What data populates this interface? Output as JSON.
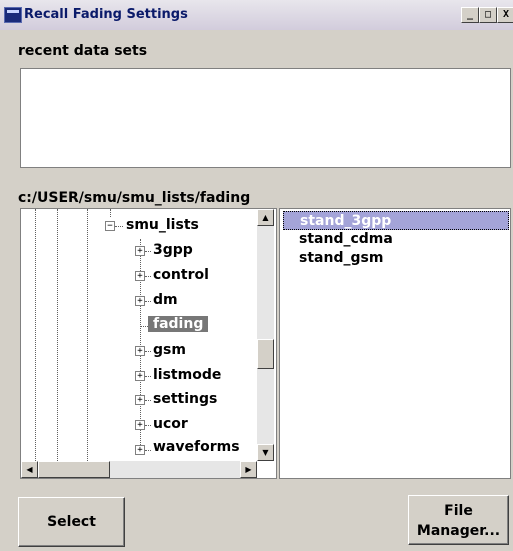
{
  "window": {
    "title": "Recall Fading Settings",
    "minimize": "_",
    "maximize": "□",
    "close": "X"
  },
  "recent": {
    "label": "recent data sets"
  },
  "directory": {
    "path": "c:/USER/smu/smu_lists/fading"
  },
  "tree": {
    "root": "smu_lists",
    "items": [
      "3gpp",
      "control",
      "dm",
      "fading",
      "gsm",
      "listmode",
      "settings",
      "ucor",
      "waveforms"
    ],
    "selected": "fading"
  },
  "files": {
    "items": [
      "stand_3gpp",
      "stand_cdma",
      "stand_gsm"
    ],
    "selected": "stand_3gpp"
  },
  "buttons": {
    "select": "Select",
    "file_manager": "File Manager..."
  }
}
